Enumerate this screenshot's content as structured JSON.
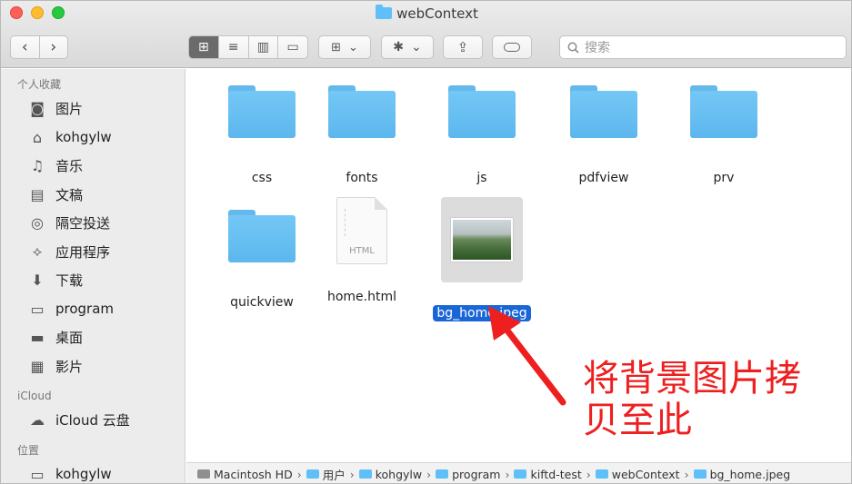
{
  "window": {
    "title": "webContext"
  },
  "toolbar": {
    "back": "‹",
    "forward": "›",
    "view_icons": "⊞",
    "view_list": "≡",
    "view_columns": "▥",
    "view_gallery": "▭",
    "group_icon": "⊞",
    "group_caret": "⌄",
    "action_icon": "✱",
    "action_caret": "⌄",
    "share_icon": "⇪",
    "search_placeholder": "搜索"
  },
  "sidebar": {
    "favorites_title": "个人收藏",
    "favorites": [
      {
        "label": "图片",
        "icon": "◙"
      },
      {
        "label": "kohgylw",
        "icon": "⌂"
      },
      {
        "label": "音乐",
        "icon": "♫"
      },
      {
        "label": "文稿",
        "icon": "▤"
      },
      {
        "label": "隔空投送",
        "icon": "◎"
      },
      {
        "label": "应用程序",
        "icon": "⟡"
      },
      {
        "label": "下载",
        "icon": "⬇"
      },
      {
        "label": "program",
        "icon": "▭"
      },
      {
        "label": "桌面",
        "icon": "▬"
      },
      {
        "label": "影片",
        "icon": "▦"
      }
    ],
    "icloud_title": "iCloud",
    "icloud_items": [
      {
        "label": "iCloud 云盘",
        "icon": "☁"
      }
    ],
    "locations_title": "位置",
    "locations": [
      {
        "label": "kohgylw",
        "icon": "▭"
      }
    ]
  },
  "files": [
    {
      "name": "css",
      "type": "folder"
    },
    {
      "name": "fonts",
      "type": "folder"
    },
    {
      "name": "js",
      "type": "folder"
    },
    {
      "name": "pdfview",
      "type": "folder"
    },
    {
      "name": "prv",
      "type": "folder"
    },
    {
      "name": "quickview",
      "type": "folder"
    },
    {
      "name": "home.html",
      "type": "html",
      "badge": "HTML"
    },
    {
      "name": "bg_home.jpeg",
      "type": "image",
      "selected": true
    }
  ],
  "annotation": {
    "line1": "将背景图片拷",
    "line2": "贝至此",
    "color": "#ee1f1f"
  },
  "pathbar": [
    "Macintosh HD",
    "用户",
    "kohgylw",
    "program",
    "kiftd-test",
    "webContext",
    "bg_home.jpeg"
  ],
  "colors": {
    "folder": "#5ec0f7",
    "selection": "#1a66d6"
  }
}
